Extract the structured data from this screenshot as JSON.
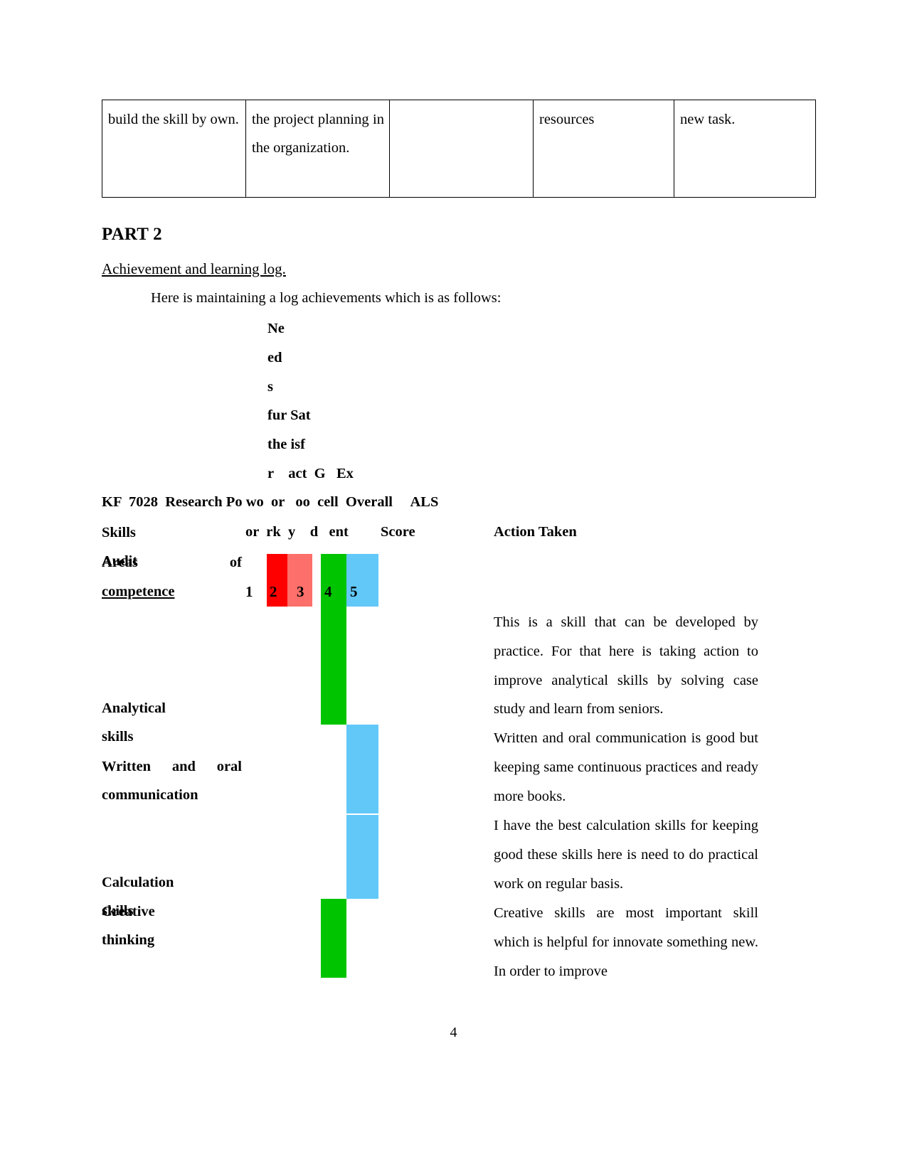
{
  "document": {
    "page_number": "4"
  },
  "top_table": {
    "rows": [
      {
        "cells": [
          "build the skill by own.",
          "the project planning in the organization.",
          "",
          "resources",
          "new task."
        ]
      }
    ]
  },
  "part_section": {
    "heading": "PART 2",
    "subheading": "Achievement and learning log.",
    "intro": "Here is maintaining a log achievements which is as follows:"
  },
  "skills_audit": {
    "vertical_headers": [
      "Ne",
      "ed",
      "s",
      "fur Sat",
      "the isf",
      "r    act  G   Ex"
    ],
    "header_row_1": "KF  7028  Research Po wo  or   oo  cell  Overall     ALS",
    "header_row_2_left": "Skills Audit",
    "header_row_2_cols": "or  rk  y    d   ent",
    "header_row_2_score": "Score",
    "header_row_2_action": "Action Taken",
    "areas_label_line1": "Areas                of",
    "areas_label_line2": "competence",
    "scale_numbers": [
      "1",
      "2",
      "3",
      "4",
      "5"
    ],
    "scale_colors": [
      "#ffffff",
      "#fe0000",
      "#fc6f6a",
      "#00c400",
      "#62c8f8"
    ],
    "rows": [
      {
        "label": "Analytical skills",
        "score": 4,
        "color": "#00c400",
        "action": "This is a skill that can be developed by practice. For that here is taking action to improve analytical skills by solving case study and learn from seniors."
      },
      {
        "label": "Written and oral communication",
        "score": 5,
        "color": "#62c8f8",
        "action": "Written and oral communication is good but keeping same continuous practices and ready more books."
      },
      {
        "label": "Calculation skills",
        "score": 5,
        "color": "#62c8f8",
        "action": "I have the best calculation skills for keeping good these skills here is need to do practical work on regular basis."
      },
      {
        "label": "Creative thinking",
        "score": 4,
        "color": "#00c400",
        "action": "Creative skills are most important skill which is helpful for innovate something new. In order to improve"
      }
    ]
  }
}
